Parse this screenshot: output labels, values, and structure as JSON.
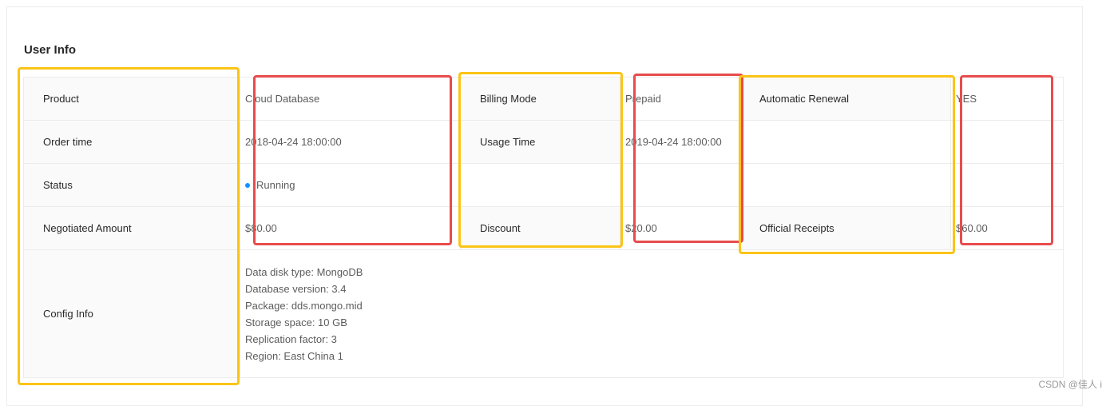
{
  "section_title": "User Info",
  "rows": {
    "product": {
      "label": "Product",
      "value": "Cloud Database"
    },
    "billing_mode": {
      "label": "Billing Mode",
      "value": "Prepaid"
    },
    "automatic_renewal": {
      "label": "Automatic Renewal",
      "value": "YES"
    },
    "order_time": {
      "label": "Order time",
      "value": "2018-04-24 18:00:00"
    },
    "usage_time": {
      "label": "Usage Time",
      "value": "2019-04-24 18:00:00"
    },
    "status": {
      "label": "Status",
      "value": "Running"
    },
    "negotiated_amount": {
      "label": "Negotiated Amount",
      "value": "$80.00"
    },
    "discount": {
      "label": "Discount",
      "value": "$20.00"
    },
    "official_receipts": {
      "label": "Official Receipts",
      "value": "$60.00"
    },
    "config_info": {
      "label": "Config Info",
      "lines": [
        "Data disk type: MongoDB",
        "Database version: 3.4",
        "Package: dds.mongo.mid",
        "Storage space: 10 GB",
        "Replication factor: 3",
        "Region: East China 1"
      ]
    }
  },
  "colors": {
    "status_dot": "#1890ff",
    "highlight_yellow": "#fbc417",
    "highlight_red": "#e84c4c",
    "label_bg": "#fafafa",
    "border": "#ececec"
  },
  "watermark": "CSDN @佳人 i"
}
